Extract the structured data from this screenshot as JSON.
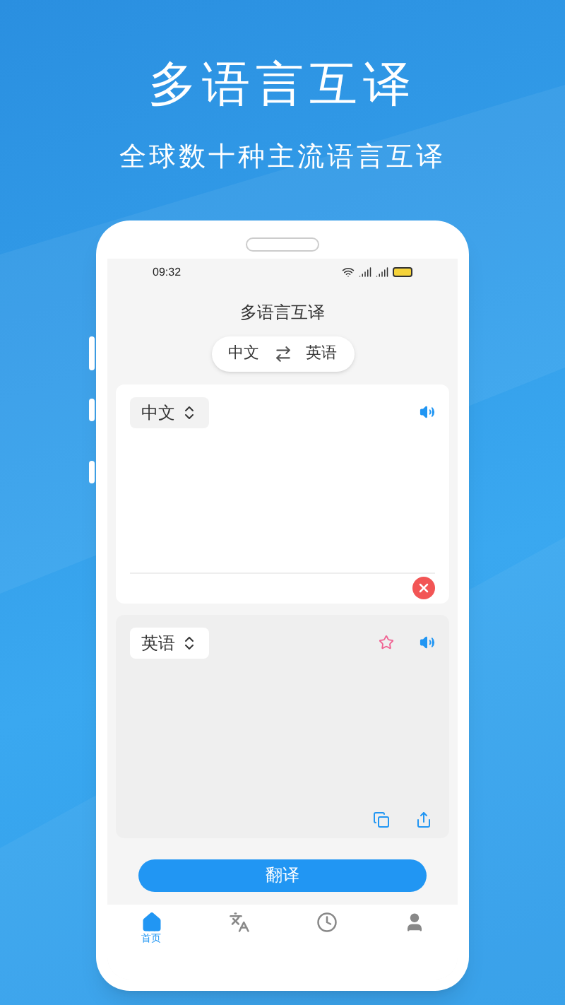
{
  "headline": "多语言互译",
  "subheadline": "全球数十种主流语言互译",
  "status_bar": {
    "time": "09:32"
  },
  "app_title": "多语言互译",
  "language_switch": {
    "source": "中文",
    "target": "英语"
  },
  "input_card": {
    "language": "中文"
  },
  "output_card": {
    "language": "英语",
    "favorited": false
  },
  "translate_button": "翻译",
  "tabs": [
    {
      "kind": "home",
      "label": "首页",
      "selected": true
    },
    {
      "kind": "translate",
      "selected": false
    },
    {
      "kind": "history",
      "selected": false
    },
    {
      "kind": "profile",
      "selected": false
    }
  ]
}
